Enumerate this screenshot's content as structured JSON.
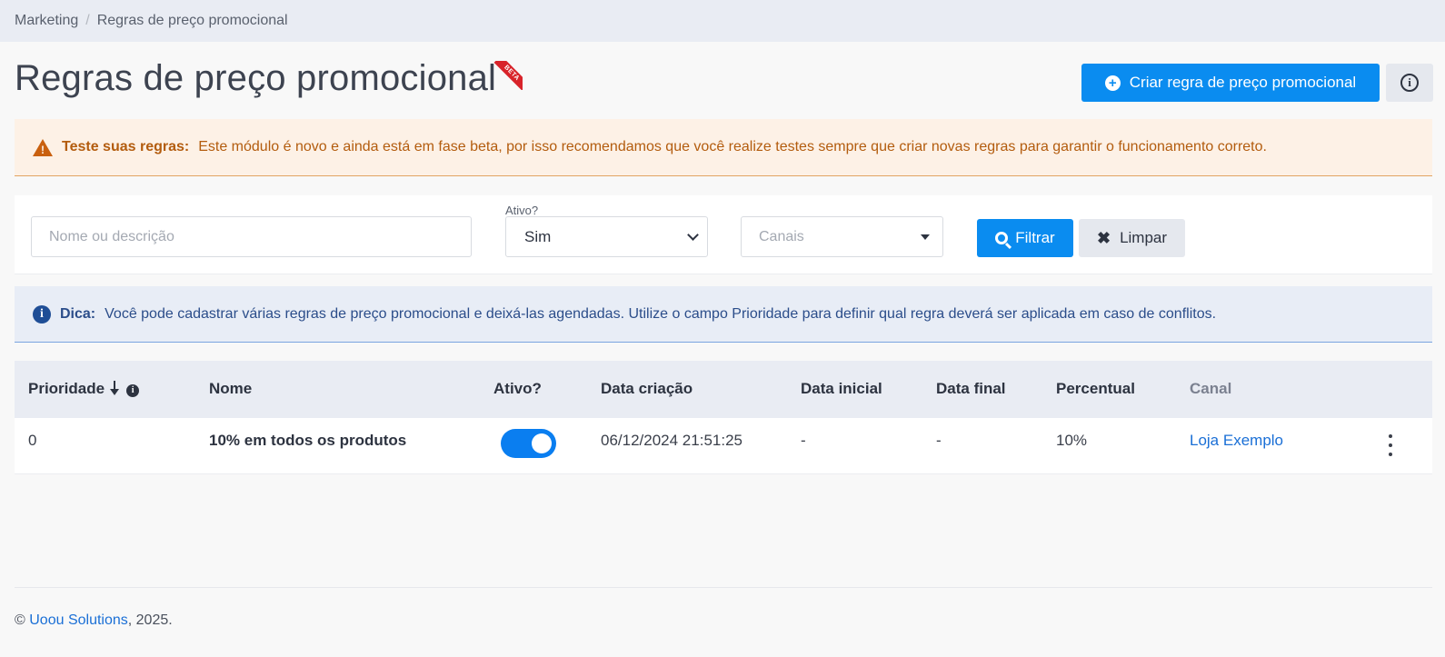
{
  "breadcrumb": {
    "parent": "Marketing",
    "separator": "/",
    "current": "Regras de preço promocional"
  },
  "page": {
    "title": "Regras de preço promocional",
    "badge": "BETA"
  },
  "actions": {
    "create_label": "Criar regra de preço promocional",
    "info_glyph": "i"
  },
  "warning": {
    "icon": "warning-icon",
    "title": "Teste suas regras:",
    "text": "Este módulo é novo e ainda está em fase beta, por isso recomendamos que você realize testes sempre que criar novas regras para garantir o funcionamento correto."
  },
  "filters": {
    "search_placeholder": "Nome ou descrição",
    "active_label": "Ativo?",
    "active_value": "Sim",
    "channels_placeholder": "Canais",
    "filter_label": "Filtrar",
    "clear_label": "Limpar"
  },
  "tip": {
    "icon": "info-icon",
    "title": "Dica:",
    "text": "Você pode cadastrar várias regras de preço promocional e deixá-las agendadas. Utilize o campo Prioridade para definir qual regra deverá ser aplicada em caso de conflitos."
  },
  "table": {
    "columns": [
      "Prioridade",
      "Nome",
      "Ativo?",
      "Data criação",
      "Data inicial",
      "Data final",
      "Percentual",
      "Canal"
    ],
    "rows": [
      {
        "priority": "0",
        "name": "10% em todos os produtos",
        "active": true,
        "created": "06/12/2024 21:51:25",
        "start": "-",
        "end": "-",
        "percent": "10%",
        "channel": "Loja Exemplo"
      }
    ]
  },
  "footer": {
    "prefix": "©",
    "company": "Uoou Solutions",
    "suffix": ", 2025."
  },
  "colors": {
    "primary": "#0a8cf0",
    "warning_text": "#b35c0e",
    "warning_bg": "#fdf1e6",
    "tip_bg": "#e8edf6",
    "link": "#1a6fd6"
  }
}
